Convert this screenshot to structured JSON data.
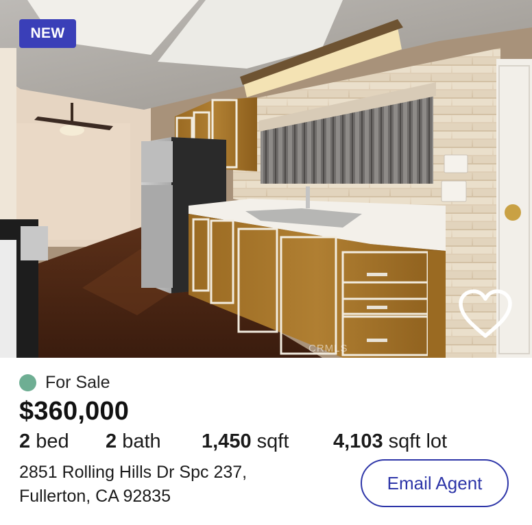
{
  "listing": {
    "badge": "NEW",
    "watermark": "CRMLS",
    "favorite_icon": "heart-outline-icon",
    "status": "For Sale",
    "status_color": "#6eae93",
    "price": "$360,000",
    "facts": {
      "beds_value": "2",
      "beds_label": "bed",
      "baths_value": "2",
      "baths_label": "bath",
      "sqft_value": "1,450",
      "sqft_label": "sqft",
      "lot_value": "4,103",
      "lot_label": "sqft lot"
    },
    "address_line1": "2851 Rolling Hills Dr Spc 237,",
    "address_line2": "Fullerton, CA 92835",
    "email_button": "Email Agent",
    "accent_color": "#2d35a8",
    "badge_color": "#3a3fb8"
  }
}
